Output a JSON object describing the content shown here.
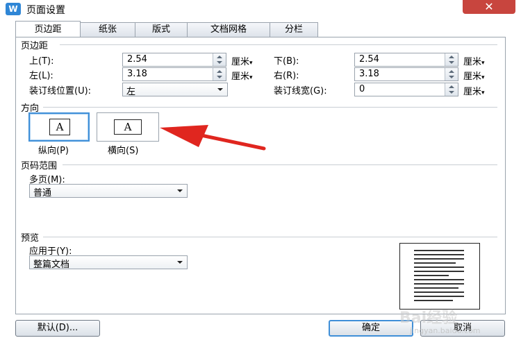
{
  "window": {
    "title": "页面设置",
    "app_icon": "W",
    "close_glyph": "✕"
  },
  "tabs": [
    {
      "label": "页边距",
      "active": true
    },
    {
      "label": "纸张",
      "active": false
    },
    {
      "label": "版式",
      "active": false
    },
    {
      "label": "文档网格",
      "active": false
    },
    {
      "label": "分栏",
      "active": false
    }
  ],
  "margins": {
    "section_title": "页边距",
    "top": {
      "label": "上(T):",
      "value": "2.54",
      "unit": "厘米"
    },
    "bottom": {
      "label": "下(B):",
      "value": "2.54",
      "unit": "厘米"
    },
    "left": {
      "label": "左(L):",
      "value": "3.18",
      "unit": "厘米"
    },
    "right": {
      "label": "右(R):",
      "value": "3.18",
      "unit": "厘米"
    },
    "gutter_position": {
      "label": "装订线位置(U):",
      "value": "左"
    },
    "gutter_width": {
      "label": "装订线宽(G):",
      "value": "0",
      "unit": "厘米"
    }
  },
  "orientation": {
    "section_title": "方向",
    "portrait": {
      "label": "纵向(P)",
      "glyph": "A",
      "selected": true
    },
    "landscape": {
      "label": "横向(S)",
      "glyph": "A",
      "selected": false
    }
  },
  "page_range": {
    "section_title": "页码范围",
    "multiple_pages": {
      "label": "多页(M):",
      "value": "普通"
    }
  },
  "preview": {
    "section_title": "预览",
    "apply_to": {
      "label": "应用于(Y):",
      "value": "整篇文档"
    }
  },
  "buttons": {
    "default": "默认(D)...",
    "ok": "确定",
    "cancel": "取消"
  },
  "watermark": {
    "text": "Bai经验",
    "url": "jingyan.baidu.com"
  },
  "colors": {
    "accent": "#3f8fd8",
    "arrow": "#e0261f",
    "close": "#c8453e"
  }
}
